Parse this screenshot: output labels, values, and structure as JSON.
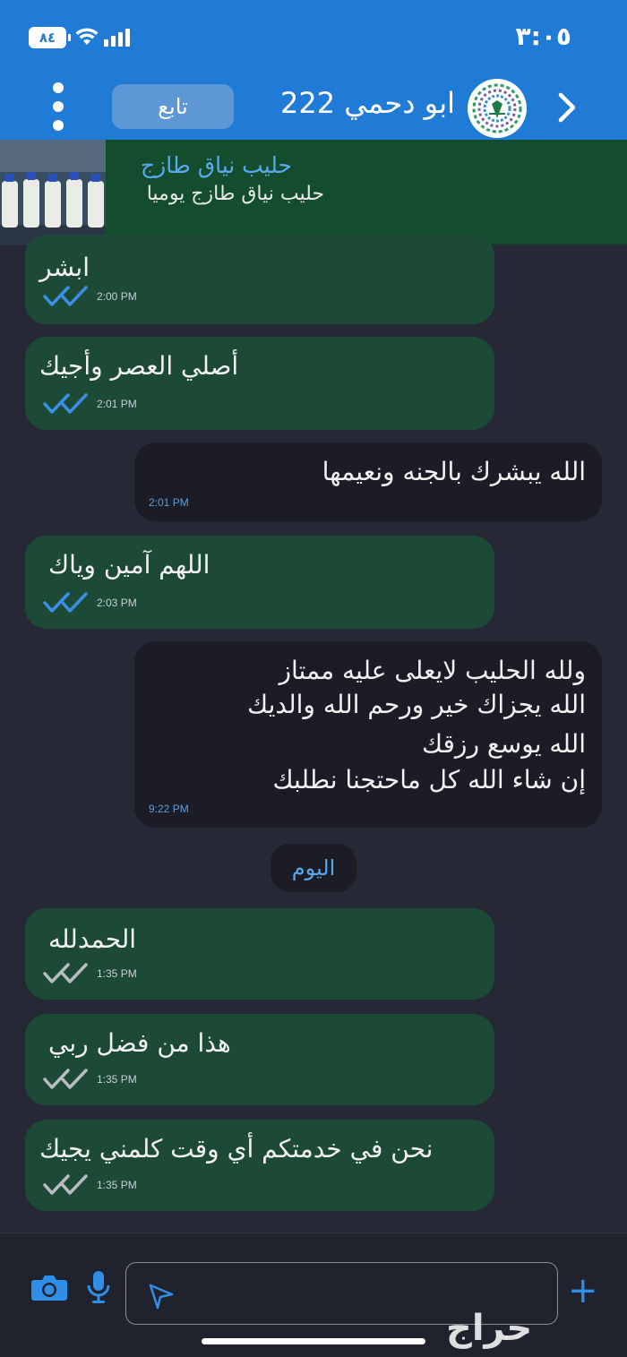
{
  "status_bar": {
    "time": "٣:٠٥",
    "battery": "٨٤"
  },
  "header": {
    "title": "ابو دحمي 222",
    "follow_label": "تابع"
  },
  "product": {
    "title": "حليب نياق طازج",
    "subtitle": "حليب نياق طازج يوميا"
  },
  "messages": [
    {
      "dir": "out",
      "text": "ابشر",
      "time": "2:00 PM",
      "read": true
    },
    {
      "dir": "out",
      "text": "أصلي العصر وأجيك",
      "time": "2:01 PM",
      "read": true
    },
    {
      "dir": "in",
      "text": "الله يبشرك بالجنه ونعيمها",
      "time": "2:01 PM"
    },
    {
      "dir": "out",
      "text": "اللهم آمين وياك",
      "time": "2:03 PM",
      "read": true
    },
    {
      "dir": "in",
      "lines": [
        "ولله الحليب لايعلى عليه ممتاز",
        "الله يجزاك خير ورحم الله والديك",
        "الله يوسع رزقك",
        "إن شاء الله كل ماحتجنا نطلبك"
      ],
      "time": "9:22 PM"
    },
    {
      "dir": "out",
      "text": "الحمدلله",
      "time": "1:35 PM",
      "read": false
    },
    {
      "dir": "out",
      "text": "هذا من فضل ربي",
      "time": "1:35 PM",
      "read": false
    },
    {
      "dir": "out",
      "text": "نحن في خدمتكم أي وقت كلمني يجيك",
      "time": "1:35 PM",
      "read": false
    }
  ],
  "day_divider": "اليوم",
  "composer": {
    "placeholder": ""
  },
  "watermark": "حراج",
  "colors": {
    "header": "#1f7bd6",
    "outgoing": "#1c4a36",
    "incoming": "#1b1c26",
    "background": "#262836",
    "read_tick": "#3b8fe6",
    "accent": "#2f8ee8"
  }
}
